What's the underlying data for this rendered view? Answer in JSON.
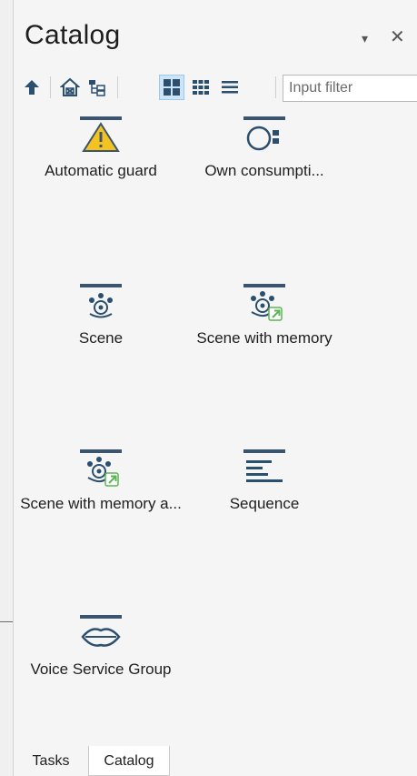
{
  "panel": {
    "title": "Catalog",
    "dropdown_glyph": "▾",
    "close_glyph": "✕"
  },
  "toolbar": {
    "buttons": [
      {
        "icon": "up-arrow-icon"
      },
      {
        "icon": "house-icon"
      },
      {
        "icon": "tree-view-icon"
      },
      {
        "icon": "large-icons-view-icon",
        "active": true
      },
      {
        "icon": "small-icons-view-icon"
      },
      {
        "icon": "list-view-icon"
      }
    ],
    "filter_placeholder": "Input filter"
  },
  "items": [
    {
      "label": "Automatic guard",
      "icon": "warning-icon"
    },
    {
      "label": "Own consumpti...",
      "icon": "own-consumption-icon"
    },
    {
      "label": "Scene",
      "icon": "scene-icon"
    },
    {
      "label": "Scene with memory",
      "icon": "scene-memory-icon"
    },
    {
      "label": "Scene with memory a...",
      "icon": "scene-memory-icon"
    },
    {
      "label": "Sequence",
      "icon": "sequence-icon"
    },
    {
      "label": "Voice Service Group",
      "icon": "voice-service-icon"
    }
  ],
  "tabs": [
    {
      "label": "Tasks",
      "active": false
    },
    {
      "label": "Catalog",
      "active": true
    }
  ],
  "colors": {
    "icon_bar": "#3b556f",
    "icon_fill": "#2b4f6f",
    "warning_yellow": "#f4c321",
    "accent_green": "#5ab552"
  }
}
